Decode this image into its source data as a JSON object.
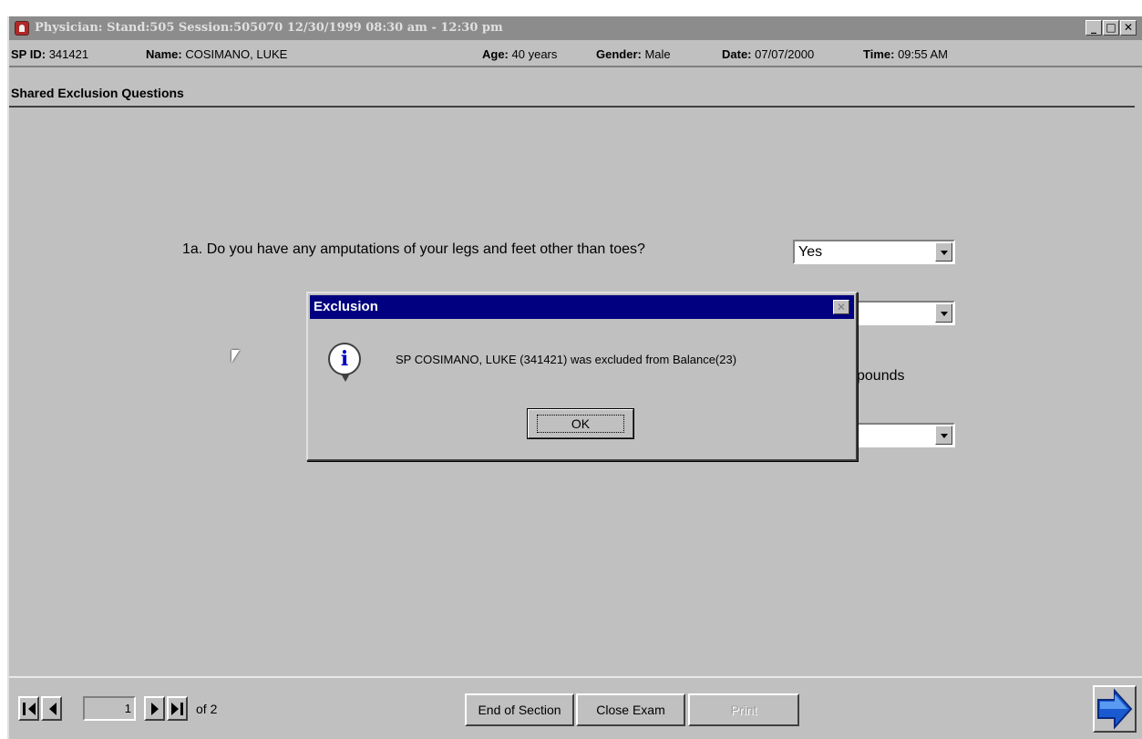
{
  "window": {
    "title": "Physician: Stand:505 Session:505070 12/30/1999 08:30 am - 12:30 pm",
    "minimize": "_",
    "maximize": "□",
    "close": "✕"
  },
  "patient": {
    "sp_id_label": "SP ID:",
    "sp_id": "341421",
    "name_label": "Name:",
    "name": "COSIMANO, LUKE",
    "age_label": "Age:",
    "age": "40 years",
    "gender_label": "Gender:",
    "gender": "Male",
    "date_label": "Date:",
    "date": "07/07/2000",
    "time_label": "Time:",
    "time": "09:55 AM"
  },
  "section": {
    "title": "Shared Exclusion Questions"
  },
  "form": {
    "question_1a": "1a. Do you have any amputations of your legs and feet other than toes?",
    "answer_1a": "Yes",
    "answer_2": "",
    "answer_4": "",
    "pounds_label": "pounds"
  },
  "dialog": {
    "title": "Exclusion",
    "close": "✕",
    "icon": "info-icon",
    "message": "SP COSIMANO, LUKE  (341421) was excluded from Balance(23)",
    "ok_label": "OK"
  },
  "bottom": {
    "page_number": "1",
    "page_of": "of 2",
    "end_section_label": "End of Section",
    "close_exam_label": "Close Exam",
    "third_button_label": "Print",
    "next_icon": "arrow-right-icon"
  },
  "colors": {
    "dialog_title_bg": "#000080",
    "window_bg": "#c0c0c0",
    "next_arrow": "#0050d0"
  }
}
